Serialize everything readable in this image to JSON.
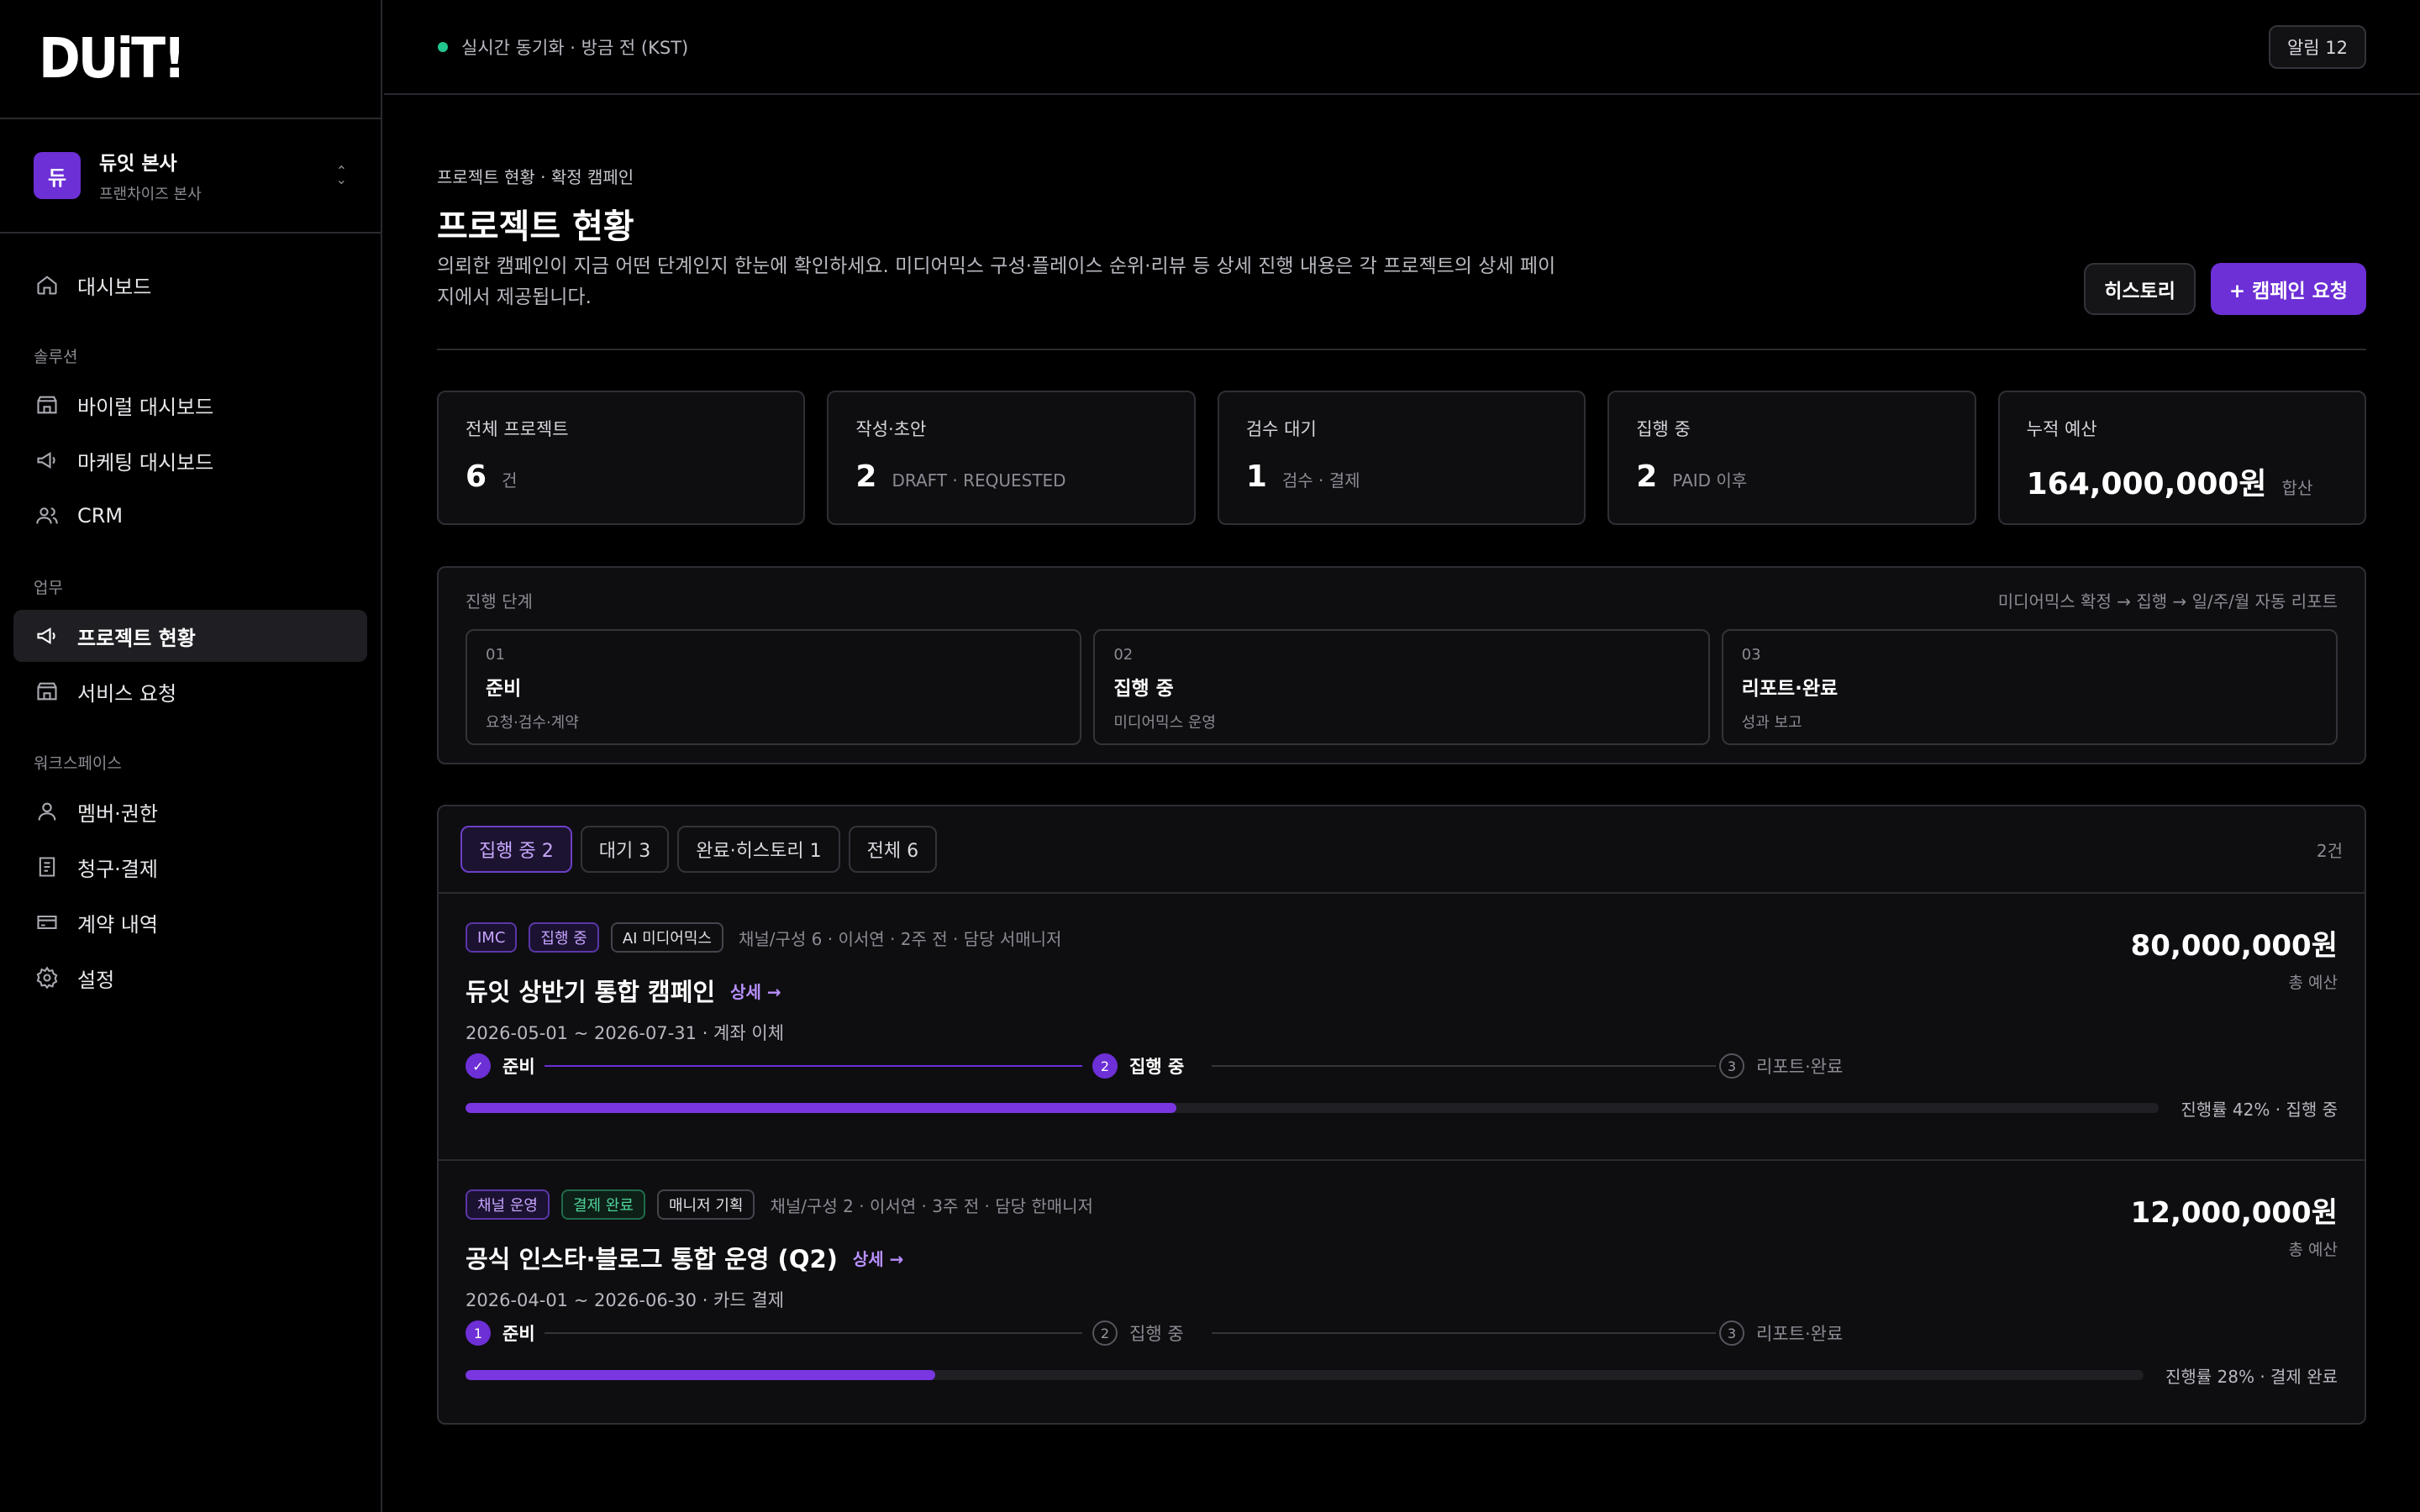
{
  "brand": {
    "logo": "DUiT!",
    "accent": "#6d2fd6"
  },
  "org": {
    "avatar": "듀",
    "name": "듀잇 본사",
    "sub": "프랜차이즈 본사"
  },
  "nav": {
    "dashboard": "대시보드",
    "section_solutions": "솔루션",
    "viral": "바이럴 대시보드",
    "marketing": "마케팅 대시보드",
    "crm": "CRM",
    "section_work": "업무",
    "projects": "프로젝트 현황",
    "service": "서비스 요청",
    "section_workspace": "워크스페이스",
    "members": "멤버·권한",
    "billing": "청구·결제",
    "contracts": "계약 내역",
    "settings": "설정"
  },
  "topbar": {
    "sync": "실시간 동기화 · 방금 전 (KST)",
    "alerts": "알림 12"
  },
  "header": {
    "breadcrumb": "프로젝트 현황 · 확정 캠페인",
    "title": "프로젝트 현황",
    "desc": "의뢰한 캠페인이 지금 어떤 단계인지 한눈에 확인하세요. 미디어믹스 구성·플레이스 순위·리뷰 등 상세 진행 내용은 각 프로젝트의 상세 페이지에서 제공됩니다.",
    "history_btn": "히스토리",
    "request_btn": "+ 캠페인 요청"
  },
  "stats": [
    {
      "label": "전체 프로젝트",
      "value": "6",
      "unit": "건"
    },
    {
      "label": "작성·초안",
      "value": "2",
      "unit": "DRAFT · REQUESTED"
    },
    {
      "label": "검수 대기",
      "value": "1",
      "unit": "검수 · 결제"
    },
    {
      "label": "집행 중",
      "value": "2",
      "unit": "PAID 이후"
    },
    {
      "label": "누적 예산",
      "value": "164,000,000원",
      "unit": "합산"
    }
  ],
  "stages": {
    "title": "진행 단계",
    "flow": "미디어믹스 확정 → 집행 → 일/주/월 자동 리포트",
    "items": [
      {
        "num": "01",
        "title": "준비",
        "sub": "요청·검수·계약"
      },
      {
        "num": "02",
        "title": "집행 중",
        "sub": "미디어믹스 운영"
      },
      {
        "num": "03",
        "title": "리포트·완료",
        "sub": "성과 보고"
      }
    ]
  },
  "tabs": {
    "items": [
      "집행 중 2",
      "대기 3",
      "완료·히스토리 1",
      "전체 6"
    ],
    "count": "2건"
  },
  "projects": [
    {
      "tags": [
        "IMC",
        "집행 중",
        "AI 미디어믹스"
      ],
      "meta": "채널/구성 6 · 이서연 · 2주 전 · 담당 서매니저",
      "title": "듀잇 상반기 통합 캠페인",
      "detail": "상세 →",
      "dates": "2026-05-01 ~ 2026-07-31  ·  계좌 이체",
      "amount": "80,000,000원",
      "amount_label": "총 예산",
      "steps": [
        {
          "icon": "✓",
          "label": "준비"
        },
        {
          "icon": "2",
          "label": "집행 중"
        },
        {
          "icon": "3",
          "label": "리포트·완료"
        }
      ],
      "progress": 42,
      "progress_label": "진행률 42% · 집행 중"
    },
    {
      "tags": [
        "채널 운영",
        "결제 완료",
        "매니저 기획"
      ],
      "meta": "채널/구성 2 · 이서연 · 3주 전 · 담당 한매니저",
      "title": "공식 인스타·블로그 통합 운영 (Q2)",
      "detail": "상세 →",
      "dates": "2026-04-01 ~ 2026-06-30  ·  카드 결제",
      "amount": "12,000,000원",
      "amount_label": "총 예산",
      "steps": [
        {
          "icon": "1",
          "label": "준비"
        },
        {
          "icon": "2",
          "label": "집행 중"
        },
        {
          "icon": "3",
          "label": "리포트·완료"
        }
      ],
      "progress": 28,
      "progress_label": "진행률 28% · 결제 완료"
    }
  ]
}
